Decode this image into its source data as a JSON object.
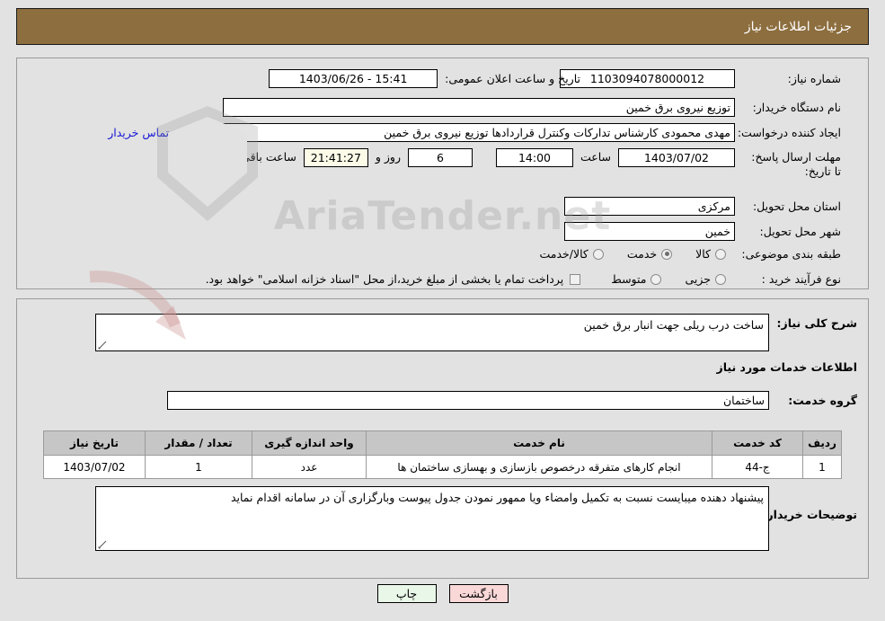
{
  "header": {
    "title": "جزئیات اطلاعات نیاز"
  },
  "form": {
    "need_number_label": "شماره نیاز:",
    "need_number_value": "1103094078000012",
    "announce_label": "تاریخ و ساعت اعلان عمومی:",
    "announce_value": "15:41 - 1403/06/26",
    "buyer_org_label": "نام دستگاه خریدار:",
    "buyer_org_value": "توزیع نیروی برق خمین",
    "requester_label": "ایجاد کننده درخواست:",
    "requester_value": "مهدی محمودی کارشناس تدارکات وکنترل قراردادها توزیع نیروی برق خمین",
    "contact_link": "اطلاعات تماس خریدار",
    "deadline_label": "مهلت ارسال پاسخ: تا تاریخ:",
    "deadline_date": "1403/07/02",
    "deadline_time_label": "ساعت",
    "deadline_time": "14:00",
    "remaining_days": "6",
    "remaining_days_label": "روز و",
    "remaining_time": "21:41:27",
    "remaining_time_label": "ساعت باقی مانده",
    "province_label": "استان محل تحویل:",
    "province_value": "مرکزی",
    "city_label": "شهر محل تحویل:",
    "city_value": "خمین",
    "category_label": "طبقه بندی موضوعی:",
    "category_options": [
      {
        "label": "کالا",
        "selected": false
      },
      {
        "label": "خدمت",
        "selected": true
      },
      {
        "label": "کالا/خدمت",
        "selected": false
      }
    ],
    "process_label": "نوع فرآیند خرید :",
    "process_options": [
      {
        "label": "جزیی",
        "selected": false
      },
      {
        "label": "متوسط",
        "selected": false
      }
    ],
    "treasury_checkbox_label": "پرداخت تمام یا بخشی از مبلغ خرید،از محل \"اسناد خزانه اسلامی\" خواهد بود.",
    "treasury_checked": false
  },
  "description": {
    "general_label": "شرح کلی نیاز:",
    "general_value": "ساخت درب ریلی جهت انبار برق خمین",
    "services_heading": "اطلاعات خدمات مورد نیاز",
    "service_group_label": "گروه خدمت:",
    "service_group_value": "ساختمان",
    "buyer_notes_label": "توضیحات خریدار:",
    "buyer_notes_value": "پیشنهاد دهنده میبایست نسبت به تکمیل وامضاء ویا ممهور نمودن جدول پیوست وبارگزاری آن در سامانه اقدام نماید"
  },
  "table": {
    "columns": [
      "ردیف",
      "کد خدمت",
      "نام خدمت",
      "واحد اندازه گیری",
      "تعداد / مقدار",
      "تاریخ نیاز"
    ],
    "rows": [
      {
        "row": "1",
        "code": "ج-44",
        "name": "انجام کارهای متفرقه درخصوص بازسازی و بهسازی ساختمان ها",
        "unit": "عدد",
        "qty": "1",
        "date": "1403/07/02"
      }
    ]
  },
  "buttons": {
    "print": "چاپ",
    "back": "بازگشت"
  },
  "watermark": {
    "text": "AriaTender.net"
  }
}
